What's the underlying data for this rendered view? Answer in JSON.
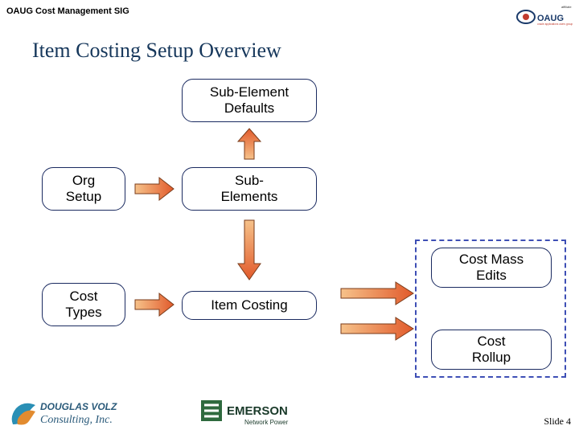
{
  "header": {
    "text": "OAUG Cost Management SIG"
  },
  "title": "Item Costing Setup Overview",
  "nodes": {
    "sub_element_defaults": "Sub-Element\nDefaults",
    "org_setup": "Org\nSetup",
    "sub_elements": "Sub-\nElements",
    "cost_types": "Cost\nTypes",
    "item_costing": "Item Costing",
    "cost_mass_edits": "Cost Mass\nEdits",
    "cost_rollup": "Cost\nRollup"
  },
  "logos": {
    "top_right": "OAUG",
    "bottom_left": "DOUGLAS VOLZ Consulting, Inc.",
    "bottom_center": "EMERSON Network Power"
  },
  "slide": {
    "label": "Slide",
    "number": "4"
  }
}
